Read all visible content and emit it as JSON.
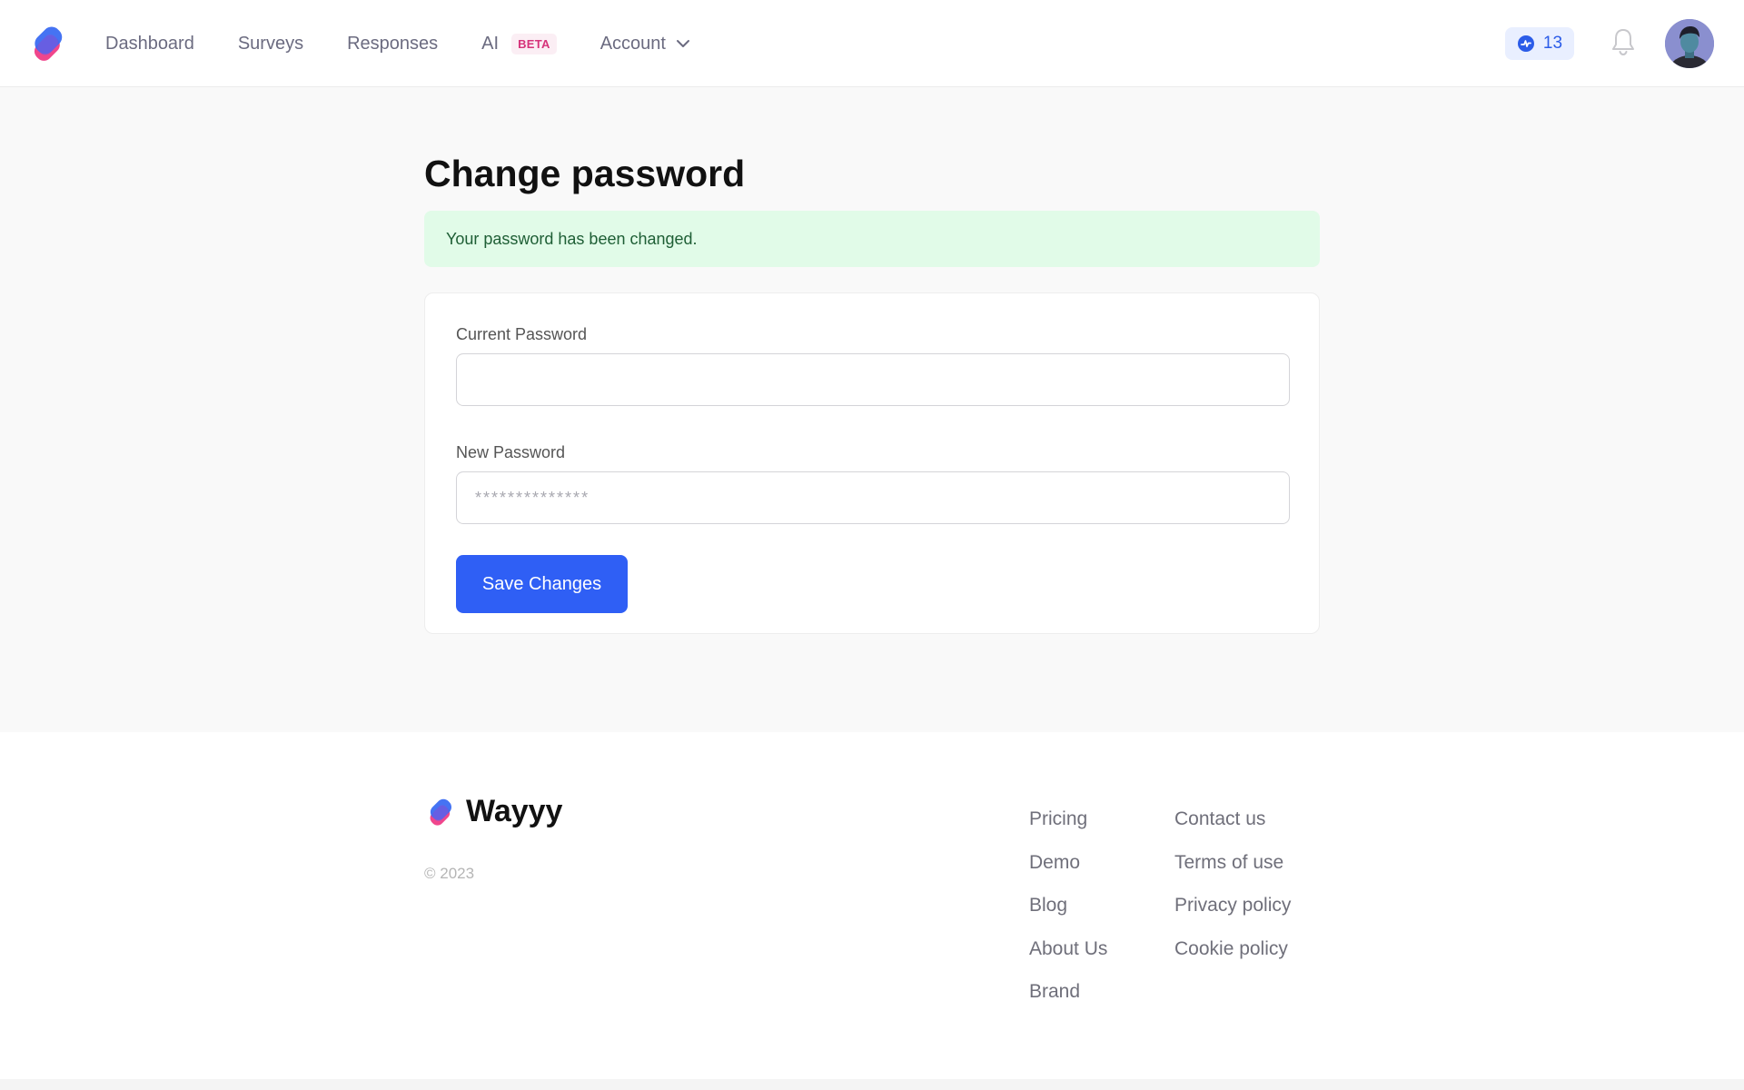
{
  "header": {
    "nav": [
      {
        "label": "Dashboard"
      },
      {
        "label": "Surveys"
      },
      {
        "label": "Responses"
      },
      {
        "label": "AI",
        "badge": "BETA"
      },
      {
        "label": "Account"
      }
    ],
    "credits": "13",
    "icons": {
      "logo": "wayyy-logo",
      "credits": "bolt-circle-icon",
      "bell": "bell-icon",
      "avatar": "user-avatar"
    },
    "colors": {
      "accent": "#2f5ff5",
      "beta": "#d6337a"
    }
  },
  "main": {
    "title": "Change password",
    "alert": "Your password has been changed.",
    "form": {
      "current_password_label": "Current Password",
      "current_password_value": "",
      "new_password_label": "New Password",
      "new_password_placeholder": "**************",
      "save_label": "Save Changes"
    }
  },
  "footer": {
    "brand": "Wayyy",
    "copyright": "© 2023",
    "col1": [
      "Pricing",
      "Demo",
      "Blog",
      "About Us",
      "Brand"
    ],
    "col2": [
      "Contact us",
      "Terms of use",
      "Privacy policy",
      "Cookie policy"
    ]
  }
}
